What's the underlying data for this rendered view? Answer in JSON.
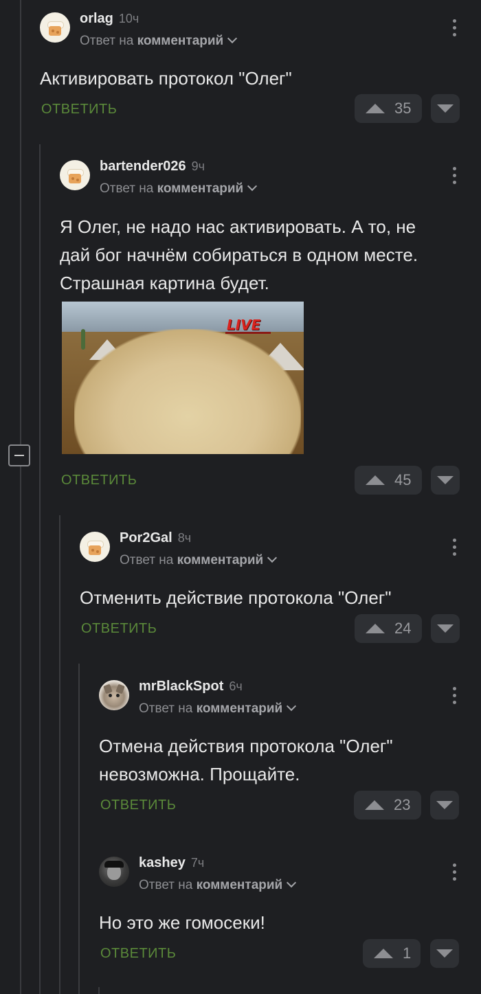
{
  "comments": [
    {
      "username": "orlag",
      "time": "10ч",
      "reply_prefix": "Ответ на",
      "reply_target": "комментарий",
      "lines": [
        "Активировать протокол \"Олег\""
      ],
      "reply_label": "ОТВЕТИТЬ",
      "rating": "35"
    },
    {
      "username": "bartender026",
      "time": "9ч",
      "reply_prefix": "Ответ на",
      "reply_target": "комментарий",
      "lines": [
        "Я Олег, не надо нас активировать. А то, не",
        "дай бог начнём собираться в одном месте.",
        "Страшная картина будет."
      ],
      "image_caption": "LIVE",
      "reply_label": "ОТВЕТИТЬ",
      "rating": "45"
    },
    {
      "username": "Por2Gal",
      "time": "8ч",
      "reply_prefix": "Ответ на",
      "reply_target": "комментарий",
      "lines": [
        "Отменить действие протокола \"Олег\""
      ],
      "reply_label": "ОТВЕТИТЬ",
      "rating": "24"
    },
    {
      "username": "mrBlackSpot",
      "time": "6ч",
      "reply_prefix": "Ответ на",
      "reply_target": "комментарий",
      "lines": [
        "Отмена действия протокола \"Олег\"",
        "невозможна. Прощайте."
      ],
      "reply_label": "ОТВЕТИТЬ",
      "rating": "23"
    },
    {
      "username": "kashey",
      "time": "7ч",
      "reply_prefix": "Ответ на",
      "reply_target": "комментарий",
      "lines": [
        "Но это же гомосеки!"
      ],
      "reply_label": "ОТВЕТИТЬ",
      "rating": "1"
    }
  ],
  "colors": {
    "background": "#1e1f22",
    "reply_green": "#5b8a3a",
    "thread_line": "#3a3b3f",
    "vote_bg": "#2e3034"
  },
  "icons": {
    "collapse": "minus-square-icon",
    "menu": "kebab-icon",
    "upvote": "triangle-up-icon",
    "downvote": "triangle-down-icon",
    "reply_chevron": "chevron-down-icon"
  }
}
